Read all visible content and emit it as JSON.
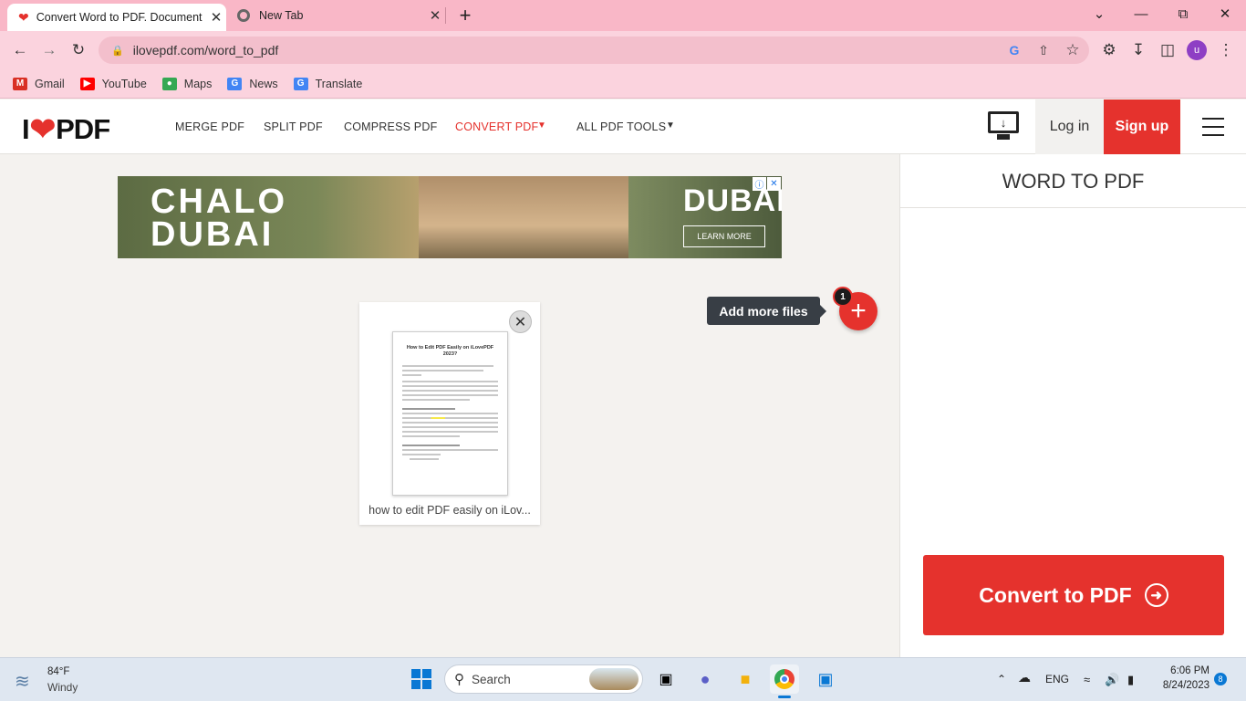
{
  "browser": {
    "tabs": [
      {
        "title": "Convert Word to PDF. Document",
        "icon": "heart-icon"
      },
      {
        "title": "New Tab",
        "icon": "chrome-icon"
      }
    ],
    "new_tab_label": "+",
    "url": "ilovepdf.com/word_to_pdf",
    "bookmarks": [
      {
        "label": "Gmail",
        "icon": "gmail-icon",
        "color": "#d93025"
      },
      {
        "label": "YouTube",
        "icon": "youtube-icon",
        "color": "#ff0000"
      },
      {
        "label": "Maps",
        "icon": "maps-icon",
        "color": "#34a853"
      },
      {
        "label": "News",
        "icon": "news-icon",
        "color": "#4285f4"
      },
      {
        "label": "Translate",
        "icon": "translate-icon",
        "color": "#4285f4"
      }
    ],
    "profile_initial": "u"
  },
  "site": {
    "logo_left": "I",
    "logo_right": "PDF",
    "nav": [
      {
        "label": "MERGE PDF",
        "active": false
      },
      {
        "label": "SPLIT PDF",
        "active": false
      },
      {
        "label": "COMPRESS PDF",
        "active": false
      },
      {
        "label": "CONVERT PDF",
        "active": true
      },
      {
        "label": "ALL PDF TOOLS",
        "active": false
      }
    ],
    "login_label": "Log in",
    "signup_label": "Sign up",
    "accent_color": "#e5322d"
  },
  "ad": {
    "headline_1": "CHALO",
    "headline_2": "DUBAI",
    "brand": "DUBAI",
    "cta": "LEARN MORE"
  },
  "workspace": {
    "file": {
      "name": "how to edit PDF easily on iLov...",
      "thumb_title": "How to Edit PDF Easily on iLovePDF 2023?"
    },
    "add_more_label": "Add more files",
    "file_count": "1"
  },
  "sidebar": {
    "title": "WORD TO PDF",
    "convert_label": "Convert to PDF"
  },
  "taskbar": {
    "weather_temp": "84°F",
    "weather_desc": "Windy",
    "search_placeholder": "Search",
    "language": "ENG",
    "time": "6:06 PM",
    "date": "8/24/2023",
    "notification_count": "8"
  }
}
